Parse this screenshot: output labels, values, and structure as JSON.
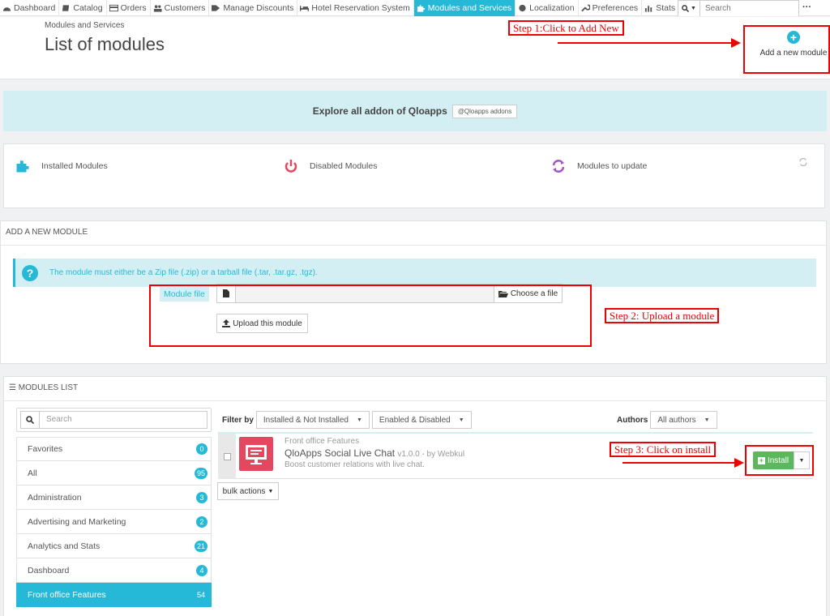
{
  "nav": {
    "items": [
      {
        "label": "Dashboard",
        "icon": "dashboard-icon"
      },
      {
        "label": "Catalog",
        "icon": "book-icon"
      },
      {
        "label": "Orders",
        "icon": "credit-card-icon"
      },
      {
        "label": "Customers",
        "icon": "users-icon"
      },
      {
        "label": "Manage Discounts",
        "icon": "tag-icon"
      },
      {
        "label": "Hotel Reservation System",
        "icon": "bed-icon"
      },
      {
        "label": "Modules and Services",
        "icon": "puzzle-icon",
        "active": true
      },
      {
        "label": "Localization",
        "icon": "globe-icon"
      },
      {
        "label": "Preferences",
        "icon": "wrench-icon"
      },
      {
        "label": "Stats",
        "icon": "bar-chart-icon"
      }
    ],
    "search_placeholder": "Search",
    "more_label": "···"
  },
  "header": {
    "breadcrumb": "Modules and Services",
    "title": "List of modules",
    "add_button_label": "Add a new module"
  },
  "annotations": {
    "step1": "Step 1:Click to Add New",
    "step2": "Step 2: Upload a module",
    "step3": "Step 3: Click on install"
  },
  "banner": {
    "text": "Explore all addon of Qloapps",
    "button_label": "@Qloapps addons"
  },
  "status": {
    "installed": "Installed Modules",
    "disabled": "Disabled Modules",
    "to_update": "Modules to update"
  },
  "add_module": {
    "heading": "ADD A NEW MODULE",
    "info": "The module must either be a Zip file (.zip) or a tarball file (.tar, .tar.gz, .tgz).",
    "file_label": "Module file",
    "choose_label": "Choose a file",
    "upload_label": "Upload this module"
  },
  "modules_list": {
    "heading": "MODULES LIST",
    "search_placeholder": "Search",
    "categories": [
      {
        "label": "Favorites",
        "count": "0"
      },
      {
        "label": "All",
        "count": "95"
      },
      {
        "label": "Administration",
        "count": "3"
      },
      {
        "label": "Advertising and Marketing",
        "count": "2"
      },
      {
        "label": "Analytics and Stats",
        "count": "21"
      },
      {
        "label": "Dashboard",
        "count": "4"
      },
      {
        "label": "Front office Features",
        "count": "54",
        "active": true
      }
    ],
    "filter_label": "Filter by",
    "filter_install": "Installed & Not Installed",
    "filter_enabled": "Enabled & Disabled",
    "authors_label": "Authors",
    "authors_value": "All authors",
    "module": {
      "category": "Front office Features",
      "name": "QloApps Social Live Chat",
      "version": "v1.0.0 - by Webkul",
      "description": "Boost customer relations with live chat.",
      "install_label": "Install"
    },
    "bulk_label": "bulk actions"
  },
  "colors": {
    "accent": "#25b9d7",
    "success": "#5cb85c",
    "annotation": "#ee0000",
    "module_logo": "#e4485f"
  }
}
